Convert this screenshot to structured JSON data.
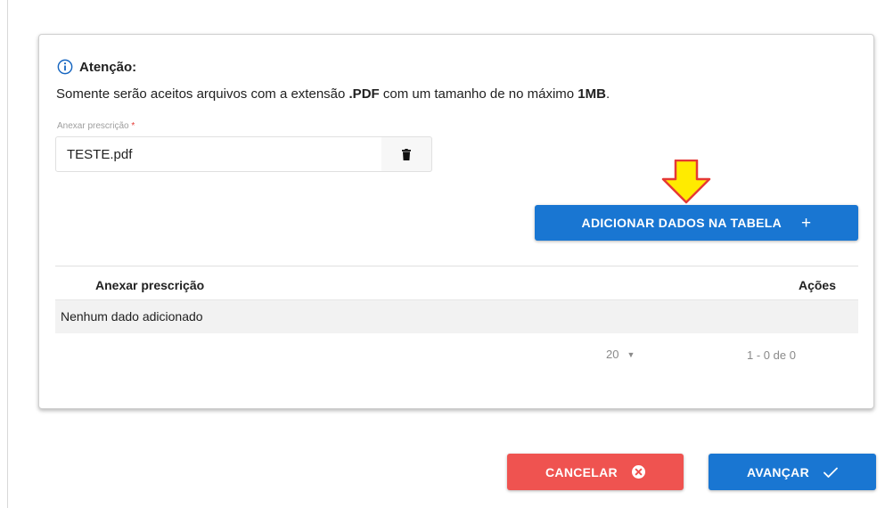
{
  "attention": {
    "title": "Atenção:",
    "message_before": "Somente serão aceitos arquivos com a extensão ",
    "message_ext": ".PDF",
    "message_middle": " com um tamanho de no máximo ",
    "message_size": "1MB",
    "message_after": ".",
    "icon": "info-icon"
  },
  "upload": {
    "label": "Anexar prescrição",
    "required_mark": "*",
    "file_name": "TESTE.pdf",
    "delete_icon": "trash-icon"
  },
  "add_button": {
    "label": "ADICIONAR DADOS NA TABELA",
    "icon_text": "+"
  },
  "table": {
    "columns": [
      "Anexar prescrição",
      "Ações"
    ],
    "empty_text": "Nenhum dado adicionado",
    "per_page": "20",
    "per_page_icon": "▼",
    "range": "1 - 0 de 0"
  },
  "actions": {
    "cancel_label": "CANCELAR",
    "cancel_icon": "close-circle-icon",
    "next_label": "AVANÇAR",
    "next_icon": "check-icon"
  },
  "colors": {
    "primary": "#1976d2",
    "danger": "#ef5350",
    "arrow_fill": "#ffeb00",
    "arrow_stroke": "#e53935"
  }
}
